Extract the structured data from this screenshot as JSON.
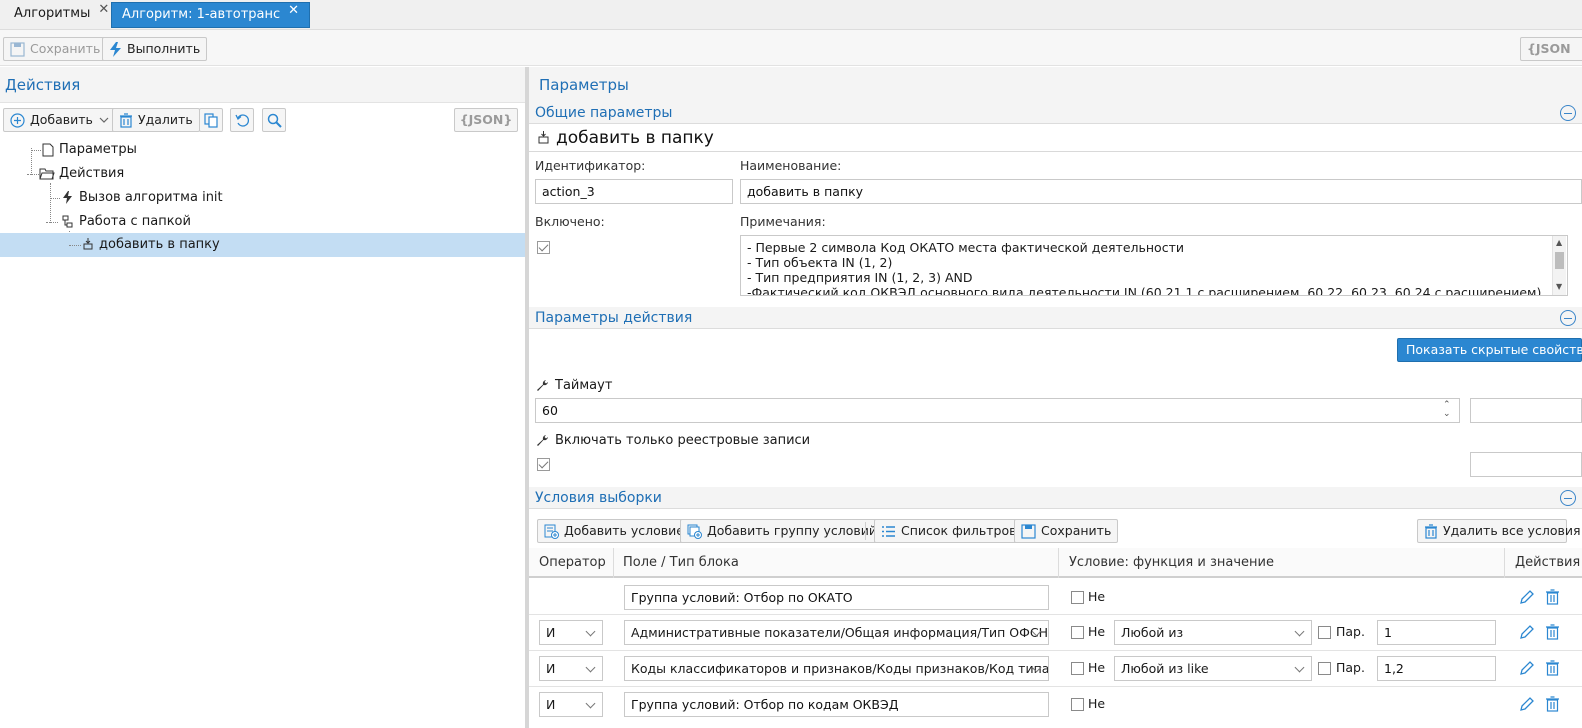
{
  "tabs": [
    {
      "label": "Алгоритмы",
      "active": false
    },
    {
      "label": "Алгоритм: 1-автотранс",
      "active": true
    }
  ],
  "toolbar": {
    "save": "Сохранить",
    "run": "Выполнить",
    "json": "{JSON"
  },
  "left": {
    "title": "Действия",
    "add": "Добавить",
    "delete": "Удалить",
    "json": "{JSON}",
    "tree": [
      {
        "label": "Параметры",
        "icon": "document-icon"
      },
      {
        "label": "Действия",
        "icon": "folder-open-icon"
      },
      {
        "label": "Вызов алгоритма init",
        "icon": "lightning-icon"
      },
      {
        "label": "Работа с папкой",
        "icon": "folder-tree-icon"
      },
      {
        "label": "добавить в папку",
        "icon": "add-to-folder-icon",
        "selected": true
      }
    ]
  },
  "right": {
    "title": "Параметры",
    "general": {
      "title": "Общие параметры",
      "heading": "добавить в папку",
      "id_label": "Идентификатор:",
      "id_value": "action_3",
      "name_label": "Наименование:",
      "name_value": "добавить в папку",
      "enabled_label": "Включено:",
      "enabled": true,
      "notes_label": "Примечания:",
      "notes": [
        "- Первые 2 символа Код ОКАТО места фактической деятельности",
        "- Тип объекта IN (1, 2)",
        "- Тип предприятия IN (1, 2, 3) AND",
        "-Фактический код ОКВЭД основного вида деятельности IN (60.21.1 с расширением, 60.22, 60.23, 60.24 с расширением)"
      ]
    },
    "action_params": {
      "title": "Параметры действия",
      "show_hidden": "Показать скрытые свойства",
      "timeout_label": "Таймаут",
      "timeout_value": "60",
      "registry_label": "Включать только реестровые записи",
      "registry": true
    },
    "conditions": {
      "title": "Условия выборки",
      "add_condition": "Добавить условие",
      "add_group": "Добавить группу условий",
      "filter_list": "Список фильтров",
      "save": "Сохранить",
      "delete_all": "Удалить все условия",
      "columns": [
        "Оператор",
        "Поле / Тип блока",
        "Условие: функция и значение",
        "Действия"
      ],
      "not_label": "Не",
      "par_label": "Пар.",
      "rows": [
        {
          "operator": "",
          "field": "Группа условий: Отбор по ОКАТО",
          "func": "",
          "value": ""
        },
        {
          "operator": "И",
          "field": "Административные показатели/Общая информация/Тип ОФСН",
          "func": "Любой из",
          "value": "1"
        },
        {
          "operator": "И",
          "field": "Коды классификаторов и признаков/Коды признаков/Код типа пре",
          "func": "Любой из like",
          "value": "1,2"
        },
        {
          "operator": "И",
          "field": "Группа условий: Отбор по кодам ОКВЭД",
          "func": "",
          "value": ""
        }
      ]
    }
  },
  "colors": {
    "accent": "#2b87d1",
    "heading": "#1f6fb5",
    "selection": "#c3ddf3"
  }
}
